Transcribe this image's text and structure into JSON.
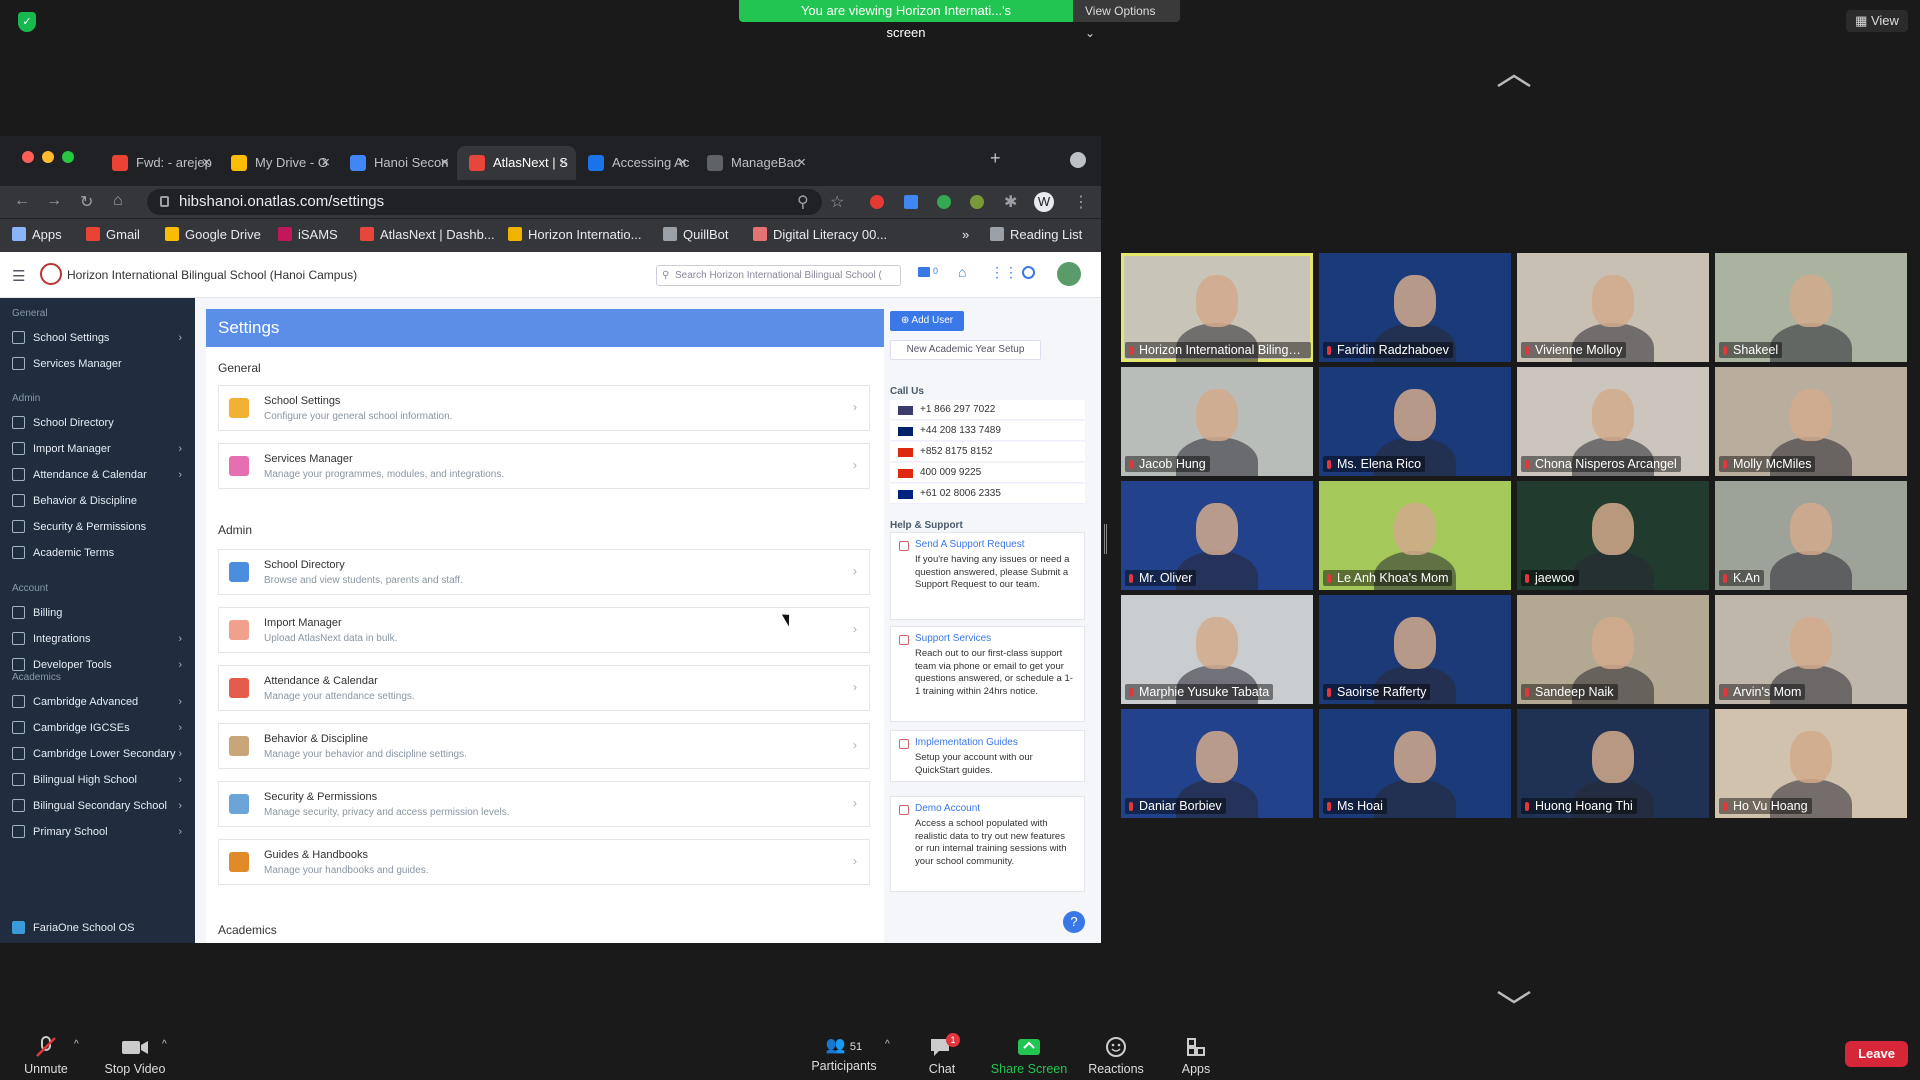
{
  "banner": {
    "message": "You are viewing Horizon Internati...'s screen",
    "view_options": "View Options"
  },
  "view": "View",
  "browser": {
    "tabs": [
      {
        "label": "Fwd: - arejep",
        "color": "#ea4335"
      },
      {
        "label": "My Drive - G",
        "color": "#fbbc04"
      },
      {
        "label": "Hanoi Secon",
        "color": "#4285f4"
      },
      {
        "label": "AtlasNext | S",
        "color": "#e8453c"
      },
      {
        "label": "Accessing Ac",
        "color": "#1a73e8"
      },
      {
        "label": "ManageBac",
        "color": "#5f6368"
      }
    ],
    "url": "hibshanoi.onatlas.com/settings",
    "bookmarks": [
      "Apps",
      "Gmail",
      "Google Drive",
      "iSAMS",
      "AtlasNext | Dashb...",
      "Horizon Internatio...",
      "QuillBot",
      "Digital Literacy 00...",
      "»",
      "Reading List"
    ]
  },
  "app": {
    "school": "Horizon International Bilingual School (Hanoi Campus)",
    "search_placeholder": "Search Horizon International Bilingual School (",
    "mail_count": "0"
  },
  "sidebar": {
    "general": "General",
    "admin": "Admin",
    "account": "Account",
    "academics": "Academics",
    "general_items": [
      {
        "label": "School Settings",
        "arrow": "›"
      },
      {
        "label": "Services Manager",
        "arrow": ""
      }
    ],
    "admin_items": [
      {
        "label": "School Directory",
        "arrow": ""
      },
      {
        "label": "Import Manager",
        "arrow": "›"
      },
      {
        "label": "Attendance & Calendar",
        "arrow": "›"
      },
      {
        "label": "Behavior & Discipline",
        "arrow": ""
      },
      {
        "label": "Security & Permissions",
        "arrow": ""
      },
      {
        "label": "Academic Terms",
        "arrow": ""
      }
    ],
    "account_items": [
      {
        "label": "Billing",
        "arrow": ""
      },
      {
        "label": "Integrations",
        "arrow": "›"
      },
      {
        "label": "Developer Tools",
        "arrow": "›"
      }
    ],
    "academics_items": [
      {
        "label": "Cambridge Advanced",
        "arrow": "›"
      },
      {
        "label": "Cambridge IGCSEs",
        "arrow": "›"
      },
      {
        "label": "Cambridge Lower Secondary",
        "arrow": "›"
      },
      {
        "label": "Bilingual High School",
        "arrow": "›"
      },
      {
        "label": "Bilingual Secondary School",
        "arrow": "›"
      },
      {
        "label": "Primary School",
        "arrow": "›"
      }
    ],
    "footer": "FariaOne School OS"
  },
  "settings": {
    "title": "Settings",
    "general": "General",
    "admin": "Admin",
    "academics": "Academics",
    "general_rows": [
      {
        "title": "School Settings",
        "desc": "Configure your general school information.",
        "color": "#f2b134"
      },
      {
        "title": "Services Manager",
        "desc": "Manage your programmes, modules, and integrations.",
        "color": "#e56fb0"
      }
    ],
    "admin_rows": [
      {
        "title": "School Directory",
        "desc": "Browse and view students, parents and staff.",
        "color": "#4d8de0"
      },
      {
        "title": "Import Manager",
        "desc": "Upload AtlasNext data in bulk.",
        "color": "#f0a08c"
      },
      {
        "title": "Attendance & Calendar",
        "desc": "Manage your attendance settings.",
        "color": "#e55b4d"
      },
      {
        "title": "Behavior & Discipline",
        "desc": "Manage your behavior and discipline settings.",
        "color": "#c9a57a"
      },
      {
        "title": "Security & Permissions",
        "desc": "Manage security, privacy and access permission levels.",
        "color": "#6aa4d8"
      },
      {
        "title": "Guides & Handbooks",
        "desc": "Manage your handbooks and guides.",
        "color": "#e08a2a"
      }
    ]
  },
  "right": {
    "add_user": "⊕ Add User",
    "new_year": "New Academic Year Setup",
    "call_us": "Call Us",
    "phones": [
      {
        "num": "+1 866 297 7022",
        "flag": "#3c3b6e"
      },
      {
        "num": "+44 208 133 7489",
        "flag": "#012169"
      },
      {
        "num": "+852 8175 8152",
        "flag": "#de2910"
      },
      {
        "num": "400 009 9225",
        "flag": "#de2910"
      },
      {
        "num": "+61 02 8006 2335",
        "flag": "#00247d"
      }
    ],
    "help": "Help & Support",
    "cards": [
      {
        "title": "Send A Support Request",
        "desc": "If you're having any issues or need a question answered, please Submit a Support Request to our team."
      },
      {
        "title": "Support Services",
        "desc": "Reach out to our first-class support team via phone or email to get your questions answered, or schedule a 1-1 training within 24hrs notice."
      },
      {
        "title": "Implementation Guides",
        "desc": "Setup your account with our QuickStart guides."
      },
      {
        "title": "Demo Account",
        "desc": "Access a school populated with realistic data to try out new features or run internal training sessions with your school community."
      }
    ]
  },
  "participants": [
    {
      "name": "Horizon International Bilingual...",
      "bg": "#c9c4b8"
    },
    {
      "name": "Faridin Radzhaboev",
      "bg": "#1b3a7a"
    },
    {
      "name": "Vivienne Molloy",
      "bg": "#c8c0b3"
    },
    {
      "name": "Shakeel",
      "bg": "#a9b3a0"
    },
    {
      "name": "Jacob Hung",
      "bg": "#b9bdb9"
    },
    {
      "name": "Ms. Elena Rico",
      "bg": "#1b3a7a"
    },
    {
      "name": "Chona Nisperos Arcangel",
      "bg": "#cbc5bd"
    },
    {
      "name": "Molly McMiles",
      "bg": "#b9ad9e"
    },
    {
      "name": "Mr. Oliver",
      "bg": "#23428c"
    },
    {
      "name": "Le Anh Khoa's Mom",
      "bg": "#a4c95a"
    },
    {
      "name": "jaewoo",
      "bg": "#223b2f"
    },
    {
      "name": "K.An",
      "bg": "#9ea39a"
    },
    {
      "name": "Marphie Yusuke Tabata",
      "bg": "#c9cdd0"
    },
    {
      "name": "Saoirse Rafferty",
      "bg": "#1d3a78"
    },
    {
      "name": "Sandeep Naik",
      "bg": "#b3a891"
    },
    {
      "name": "Arvin's Mom",
      "bg": "#bfb7aa"
    },
    {
      "name": "Daniar Borbiev",
      "bg": "#23428c"
    },
    {
      "name": "Ms Hoai",
      "bg": "#1b3a7a"
    },
    {
      "name": "Huong Hoang Thi",
      "bg": "#1f3254"
    },
    {
      "name": "Ho Vu Hoang",
      "bg": "#d1c2ad"
    }
  ],
  "toolbar": {
    "unmute": "Unmute",
    "stop_video": "Stop Video",
    "participants": "Participants",
    "participant_count": "51",
    "chat": "Chat",
    "chat_badge": "1",
    "share": "Share Screen",
    "reactions": "Reactions",
    "apps": "Apps",
    "leave": "Leave"
  },
  "colors": {
    "share_green": "#23c552",
    "leave_red": "#d72638",
    "atlas_blue": "#5b8ee6"
  }
}
